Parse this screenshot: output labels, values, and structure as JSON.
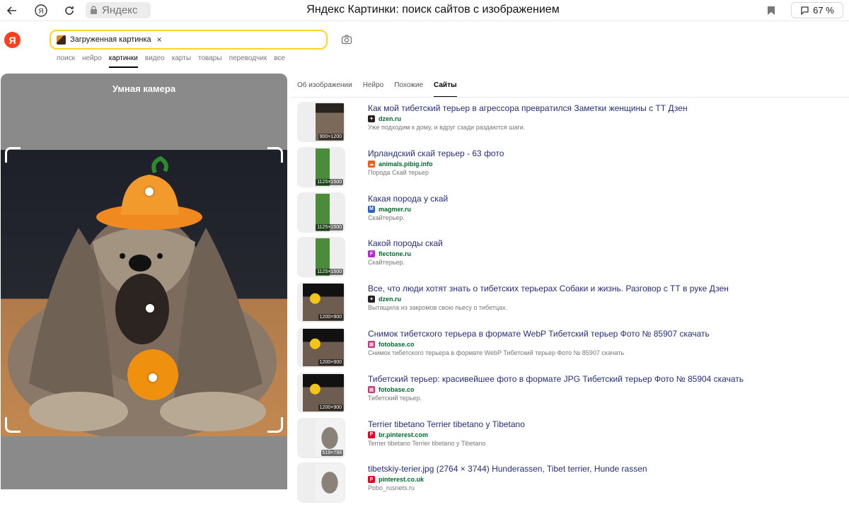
{
  "browser": {
    "title": "Яндекс Картинки: поиск сайтов с изображением",
    "address": "Яндекс",
    "zoom": "67 %"
  },
  "header": {
    "logo": "Я",
    "search_value": "Загруженная картинка",
    "clear": "×",
    "nav": [
      "поиск",
      "нейро",
      "картинки",
      "видео",
      "карты",
      "товары",
      "переводчик",
      "все"
    ]
  },
  "left_panel": {
    "title": "Умная камера"
  },
  "right_tabs": [
    "Об изображении",
    "Нейро",
    "Похожие",
    "Сайты"
  ],
  "results": [
    {
      "title": "Как мой тибетский терьер в агрессора превратился Заметки женщины с ТТ Дзен",
      "domain": "dzen.ru",
      "snippet": "Уже подходим к дому, и вдруг сзади раздаются шаги.",
      "dims": "900×1200",
      "fav": "dzen"
    },
    {
      "title": "Ирландский скай терьер - 63 фото",
      "domain": "animals.pibig.info",
      "snippet": "Порода Скай терьер",
      "dims": "1125×1500",
      "fav": "cloud"
    },
    {
      "title": "Какая порода у скай",
      "domain": "magmer.ru",
      "snippet": "Скайтерьер.",
      "dims": "1125×1500",
      "fav": "M"
    },
    {
      "title": "Какой породы скай",
      "domain": "flectone.ru",
      "snippet": "Скайтерьер.",
      "dims": "1125×1500",
      "fav": "F"
    },
    {
      "title": "Все, что люди хотят знать о тибетских терьерах Собаки и жизнь. Разговор с ТТ в руке Дзен",
      "domain": "dzen.ru",
      "snippet": "Вытащила из закромов свою пьесу о тибетцах.",
      "dims": "1200×900",
      "fav": "dzen"
    },
    {
      "title": "Снимок тибетского терьера в формате WebP Тибетский терьер Фото № 85907 скачать",
      "domain": "fotobase.co",
      "snippet": "Снимок тибетского терьера в формате WebP Тибетский терьер Фото № 85907 скачать",
      "dims": "1200×900",
      "fav": "fb"
    },
    {
      "title": "Тибетский терьер: красивейшее фото в формате JPG Тибетский терьер Фото № 85904 скачать",
      "domain": "fotobase.co",
      "snippet": "Тибетский терьер.",
      "dims": "1200×900",
      "fav": "fb"
    },
    {
      "title": "Terrier tibetano Terrier tibetano y Tibetano",
      "domain": "br.pinterest.com",
      "snippet": "Terrier tibetano Terrier tibetano y Tibetano",
      "dims": "519×798",
      "fav": "P"
    },
    {
      "title": "tibetskiy-terier.jpg (2764 × 3744) Hunderassen, Tibet terrier, Hunde rassen",
      "domain": "pinterest.co.uk",
      "snippet": "Pobo_rusnets.ru",
      "dims": "",
      "fav": "P"
    }
  ]
}
